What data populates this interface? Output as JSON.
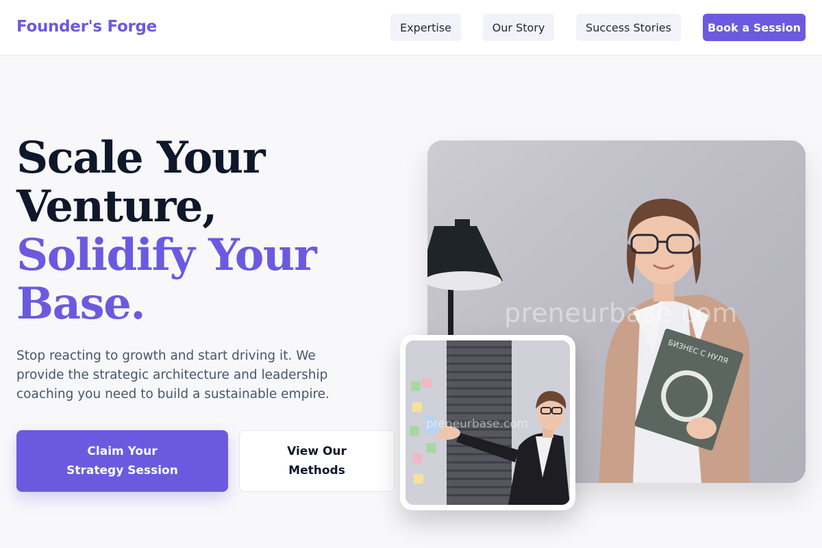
{
  "nav": {
    "brand": "Founder's Forge",
    "links": [
      "Expertise",
      "Our Story",
      "Success Stories"
    ],
    "cta": "Book a Session"
  },
  "hero": {
    "headline_line1": "Scale Your",
    "headline_line2": "Venture,",
    "headline_accent1": "Solidify Your",
    "headline_accent2": "Base.",
    "subtext": "Stop reacting to growth and start driving it. We provide the strategic architecture and leadership coaching you need to build a sustainable empire.",
    "primary_button": "Claim Your Strategy Session",
    "secondary_button": "View Our Methods"
  },
  "images": {
    "main_watermark": "preneurbase.com",
    "book_title": "БИЗНЕС С НУЛЯ",
    "inset_watermark": "preneurbase.com"
  },
  "colors": {
    "accent": "#6b5ae0",
    "headline": "#0f172a",
    "body_text": "#475569",
    "page_bg": "#f8f8fb"
  }
}
